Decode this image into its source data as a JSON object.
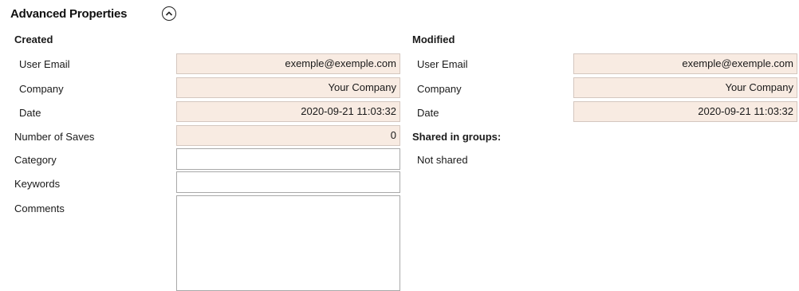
{
  "section": {
    "title": "Advanced Properties",
    "collapse_icon": "chevron-up-icon"
  },
  "created": {
    "title": "Created",
    "user_email_label": "User Email",
    "user_email_value": "exemple@exemple.com",
    "company_label": "Company",
    "company_value": "Your Company",
    "date_label": "Date",
    "date_value": "2020-09-21 11:03:32"
  },
  "saves": {
    "label": "Number of Saves",
    "value": "0"
  },
  "category": {
    "label": "Category",
    "value": ""
  },
  "keywords": {
    "label": "Keywords",
    "value": ""
  },
  "comments": {
    "label": "Comments",
    "value": ""
  },
  "modified": {
    "title": "Modified",
    "user_email_label": "User Email",
    "user_email_value": "exemple@exemple.com",
    "company_label": "Company",
    "company_value": "Your Company",
    "date_label": "Date",
    "date_value": "2020-09-21 11:03:32"
  },
  "shared": {
    "title": "Shared in groups:",
    "status": "Not shared"
  },
  "colors": {
    "readonly_bg": "#f8ebe2",
    "readonly_border": "#d4c7bf"
  }
}
